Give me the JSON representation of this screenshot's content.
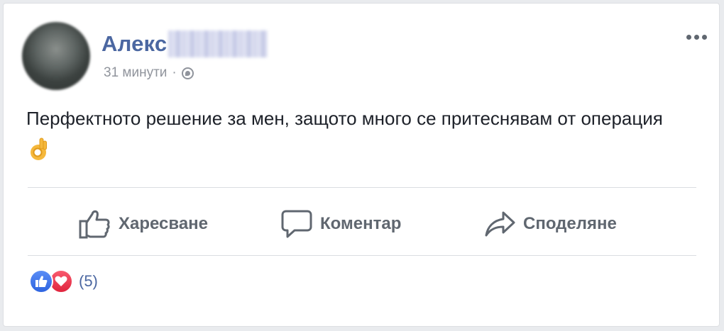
{
  "post": {
    "author_name": "Алекс",
    "timestamp": "31 минути",
    "separator": "·",
    "privacy_icon": "globe-icon",
    "text": "Перфектното решение за мен, защото много се притеснявам от операция",
    "emoji": "ok-hand-emoji"
  },
  "actions": {
    "like_label": "Харесване",
    "comment_label": "Коментар",
    "share_label": "Споделяне"
  },
  "reactions": {
    "types": [
      "like",
      "love"
    ],
    "count_label": "(5)"
  },
  "colors": {
    "author_name": "#4b67a1",
    "meta_text": "#90949c",
    "action_text": "#606770",
    "like_blue": "#2e64e0",
    "love_red": "#e0243d"
  }
}
